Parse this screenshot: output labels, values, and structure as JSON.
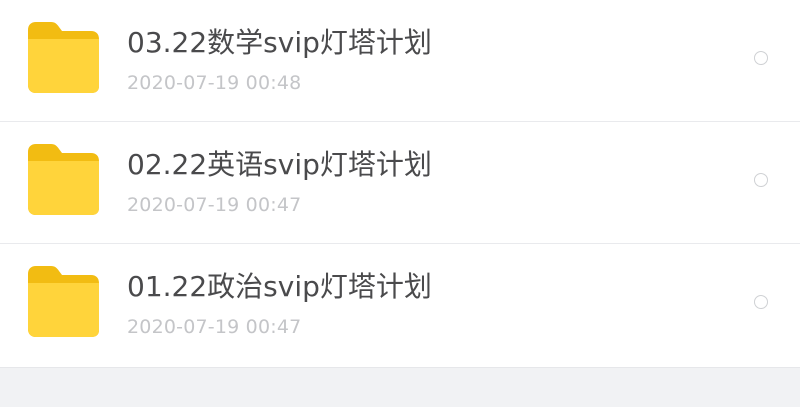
{
  "files": [
    {
      "name": "03.22数学svip灯塔计划",
      "time": "2020-07-19  00:48",
      "icon": "folder-icon"
    },
    {
      "name": "02.22英语svip灯塔计划",
      "time": "2020-07-19  00:47",
      "icon": "folder-icon"
    },
    {
      "name": "01.22政治svip灯塔计划",
      "time": "2020-07-19  00:47",
      "icon": "folder-icon"
    }
  ],
  "colors": {
    "folder_front": "#ffd43b",
    "folder_back": "#f2bc12",
    "title_text": "#4a4a4c",
    "time_text": "#c4c5c8"
  }
}
